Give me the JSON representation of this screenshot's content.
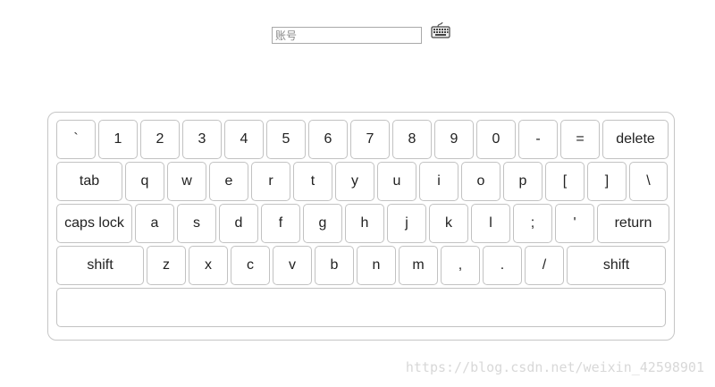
{
  "account": {
    "placeholder": "账号",
    "value": ""
  },
  "keyboard_icon": "keyboard-icon",
  "keyboard": {
    "rows": [
      [
        "`",
        "1",
        "2",
        "3",
        "4",
        "5",
        "6",
        "7",
        "8",
        "9",
        "0",
        "-",
        "=",
        "delete"
      ],
      [
        "tab",
        "q",
        "w",
        "e",
        "r",
        "t",
        "y",
        "u",
        "i",
        "o",
        "p",
        "[",
        "]",
        "\\"
      ],
      [
        "caps lock",
        "a",
        "s",
        "d",
        "f",
        "g",
        "h",
        "j",
        "k",
        "l",
        ";",
        "'",
        "return"
      ],
      [
        "shift",
        "z",
        "x",
        "c",
        "v",
        "b",
        "n",
        "m",
        ",",
        ".",
        "/",
        "shift"
      ],
      [
        ""
      ]
    ]
  },
  "watermark": "https://blog.csdn.net/weixin_42598901"
}
